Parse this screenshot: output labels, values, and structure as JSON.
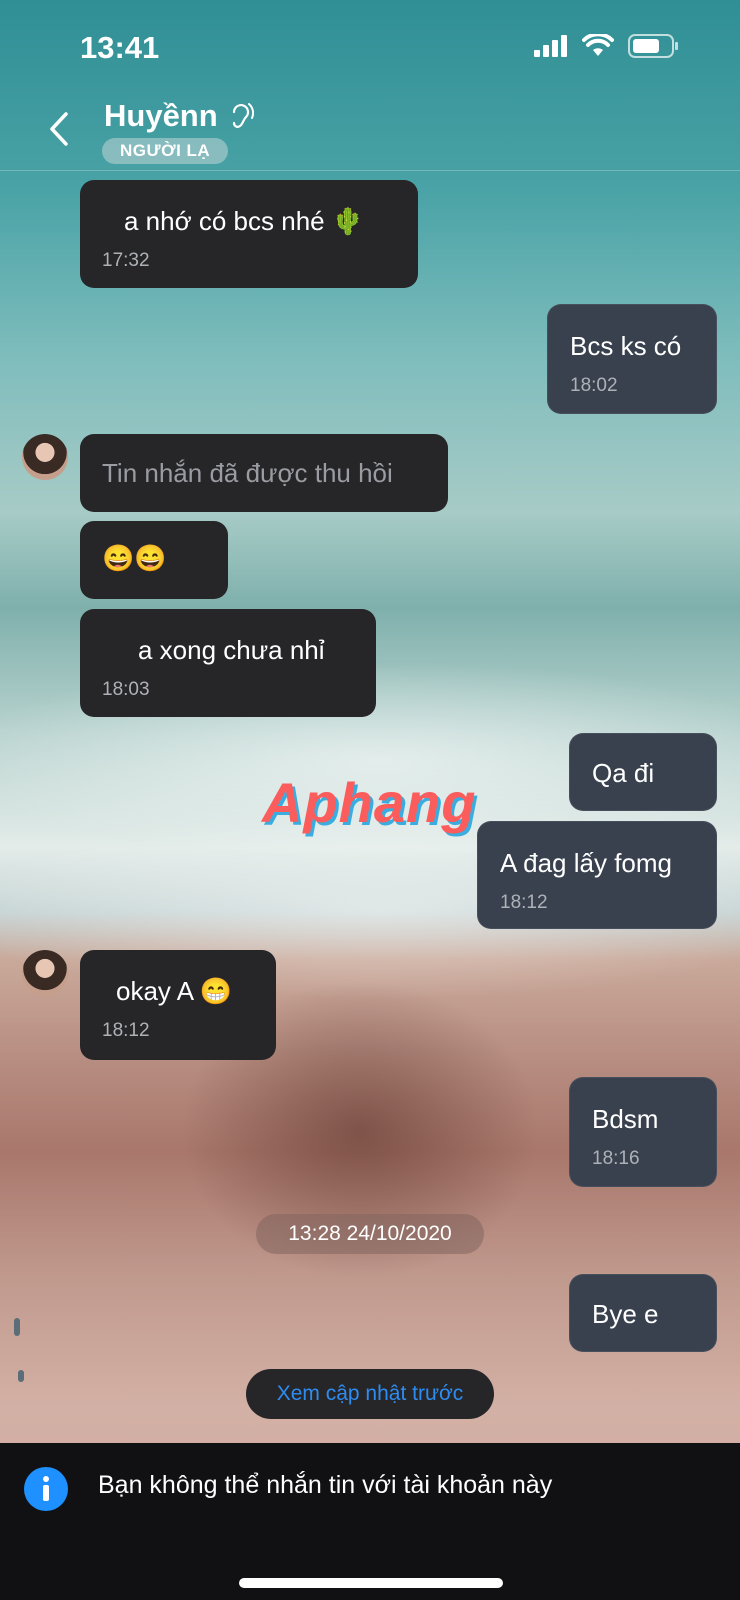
{
  "status_bar": {
    "time": "13:41"
  },
  "header": {
    "contact_name": "Huyềnn",
    "badge": "NGƯỜI LẠ"
  },
  "messages": [
    {
      "text": "a nhớ có bcs nhé 🌵",
      "time": "17:32"
    },
    {
      "text": "Bcs ks có",
      "time": "18:02"
    },
    {
      "text": "Tin nhắn đã được thu hồi"
    },
    {
      "text": "😄😄"
    },
    {
      "text": "a xong chưa nhỉ",
      "time": "18:03"
    },
    {
      "text": "Qa đi"
    },
    {
      "text": "A đag lấy fomg",
      "time": "18:12"
    },
    {
      "text": "okay A 😁",
      "time": "18:12"
    },
    {
      "text": "Bdsm",
      "time": "18:16"
    },
    {
      "text": "Bye e"
    }
  ],
  "date_separator": "13:28 24/10/2020",
  "prev_updates_label": "Xem cập nhật trước",
  "notice": "Bạn không thể nhắn tin với tài khoản này",
  "watermark": "Aphang",
  "colors": {
    "accent": "#2e8cf0",
    "info_icon": "#1e90ff"
  }
}
